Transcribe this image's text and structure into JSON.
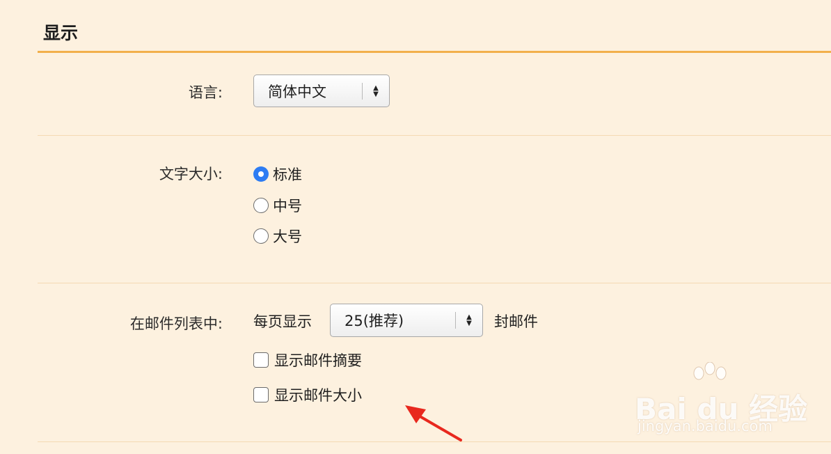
{
  "section": {
    "title": "显示"
  },
  "language": {
    "label": "语言:",
    "selected": "简体中文"
  },
  "font_size": {
    "label": "文字大小:",
    "options": [
      {
        "label": "标准",
        "checked": true
      },
      {
        "label": "中号",
        "checked": false
      },
      {
        "label": "大号",
        "checked": false
      }
    ]
  },
  "mail_list": {
    "label": "在邮件列表中:",
    "per_page_prefix": "每页显示",
    "per_page_selected": "25(推荐)",
    "per_page_suffix": "封邮件",
    "checkboxes": [
      {
        "label": "显示邮件摘要",
        "checked": false
      },
      {
        "label": "显示邮件大小",
        "checked": false
      }
    ]
  },
  "watermark": {
    "brand": "Bai du 经验",
    "url": "jingyan.baidu.com"
  },
  "colors": {
    "background": "#fdf1df",
    "accent_rule": "#f2b04b",
    "radio_checked": "#2d7cf3",
    "annotation_arrow": "#e8281e"
  },
  "icons": {
    "select_arrows": "up-down-chevron-icon",
    "annotation": "red-arrow-icon",
    "watermark_logo": "baidu-paw-icon"
  }
}
